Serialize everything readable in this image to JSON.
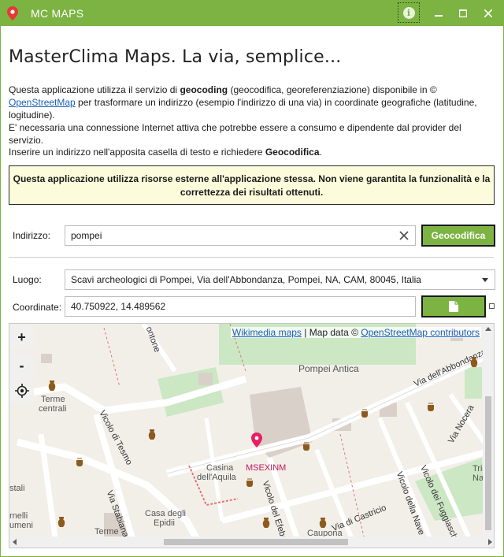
{
  "window": {
    "title": "MC MAPS",
    "accent_color": "#7cb342"
  },
  "header": {
    "heading": "MasterClima Maps. La via, semplice..."
  },
  "intro": {
    "line1_a": "Questa applicazione utilizza il servizio di ",
    "line1_bold": "geocoding",
    "line1_b": " (geocodifica, georeferenziazione) disponibile in ©",
    "link": "OpenStreetMap",
    "line2": " per trasformare un indirizzo (esempio l'indirizzo di una via) in coordinate geografiche (latitudine, logitudine).",
    "line3": "E' necessaria una connessione Internet attiva che potrebbe essere a consumo e dipendente dal provider del servizio.",
    "instruction_a": "Inserire un indirizzo nell'apposita casella di testo e richiedere ",
    "instruction_bold": "Geocodifica",
    "instruction_b": "."
  },
  "warning": {
    "text": "Questa applicazione utilizza risorse esterne all'applicazione stessa. Non viene garantita la funzionalità e la correttezza dei risultati ottenuti."
  },
  "address": {
    "label": "Indirizzo:",
    "value": "pompei",
    "geocode_label": "Geocodifica"
  },
  "place": {
    "label": "Luogo:",
    "selected": "Scavi archeologici di Pompei, Via dell'Abbondanza, Pompei, NA, CAM, 80045, Italia"
  },
  "coords": {
    "label": "Coordinate:",
    "value": "40.750922, 14.489562"
  },
  "map": {
    "zoom_in": "+",
    "zoom_out": "-",
    "attribution_link1": "Wikimedia maps",
    "attribution_mid": " | Map data © ",
    "attribution_link2": "OpenStreetMap contributors",
    "labels": {
      "pompei_antica": "Pompei Antica",
      "via_abbondanza": "Via dell'Abbondanza",
      "via_nocera": "Via Nocera",
      "vicolo_tesmo": "Vicolo di Tesmo",
      "terme_centrali_1": "Terme",
      "terme_centrali_2": "centrali",
      "casina_1": "Casina",
      "casina_2": "dell'Aquila",
      "marker": "MSEXINM",
      "vicolo_efebo": "Vicolo del Efebo",
      "via_castricio": "Via di Castricio",
      "vicolo_nave": "Vicolo della Nave Europa",
      "vicolo_fuggiaschi": "Vicolo dei Fuggiaschi",
      "via_stabiana": "Via Stabiana",
      "casa_epidii_1": "Casa degli",
      "casa_epidii_2": "Epidii",
      "terme_bottom": "Terme",
      "ontone": "ontone",
      "stali": "stali",
      "rnelli": "rnelli",
      "umeni": "umeni",
      "caupona": "Caupona",
      "trics": "Tric",
      "nave": "Nav"
    }
  }
}
